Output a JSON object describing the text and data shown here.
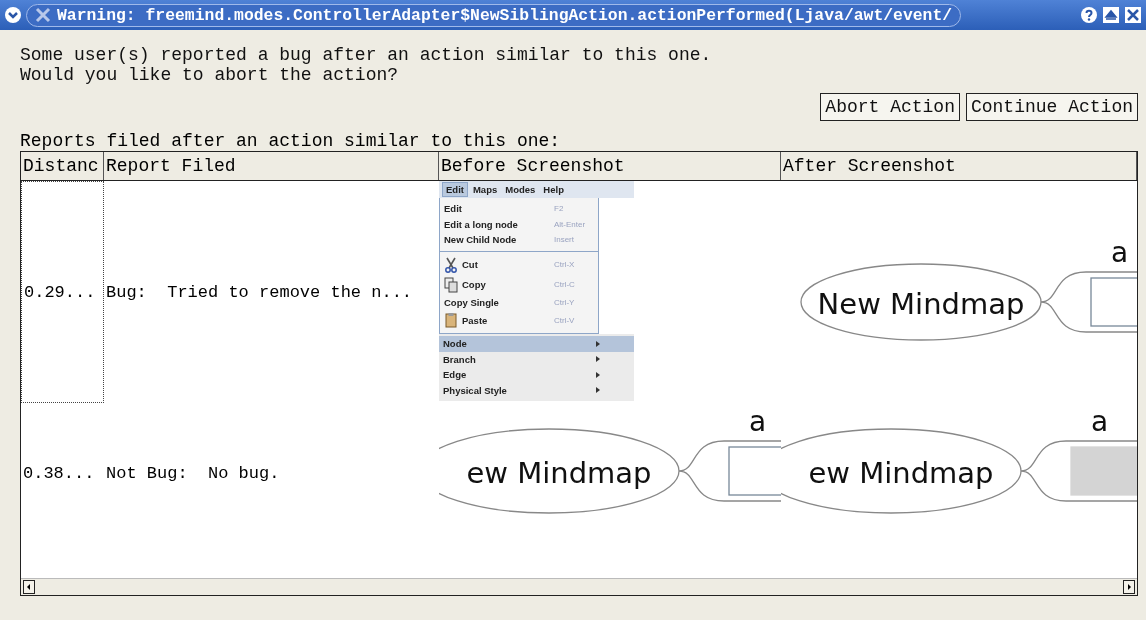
{
  "window": {
    "title": "Warning: freemind.modes.ControllerAdapter$NewSiblingAction.actionPerformed(Ljava/awt/event/"
  },
  "message": [
    "Some user(s) reported a bug after an action similar to this one.",
    "Would you like to abort the action?"
  ],
  "buttons": [
    "Abort Action",
    "Continue Action"
  ],
  "reports_label": "Reports filed after an action similar to this one:",
  "table": {
    "columns": [
      "Distanc",
      "Report Filed",
      "Before Screenshot",
      "After Screenshot"
    ],
    "rows": [
      {
        "distance": "0.29...",
        "report": "Bug:  Tried to remove the n...",
        "focused": true,
        "before": {
          "kind": "menu",
          "menubar": [
            {
              "label": "Edit",
              "selected": true
            },
            {
              "label": "Maps",
              "selected": false
            },
            {
              "label": "Modes",
              "selected": false
            },
            {
              "label": "Help",
              "selected": false
            }
          ],
          "sections": [
            {
              "items": [
                {
                  "kind": "plain",
                  "label": "Edit",
                  "shortcut": "F2"
                },
                {
                  "kind": "plain",
                  "label": "Edit a long node",
                  "shortcut": "Alt-Enter"
                },
                {
                  "kind": "plain",
                  "label": "New Child Node",
                  "shortcut": "Insert"
                }
              ]
            },
            {
              "items": [
                {
                  "kind": "cut",
                  "label": "Cut",
                  "shortcut": "Ctrl-X"
                },
                {
                  "kind": "copy",
                  "label": "Copy",
                  "shortcut": "Ctrl-C"
                },
                {
                  "kind": "plain",
                  "label": "Copy Single",
                  "shortcut": "Ctrl-Y"
                },
                {
                  "kind": "paste",
                  "label": "Paste",
                  "shortcut": "Ctrl-V"
                }
              ]
            },
            {
              "items": [
                {
                  "kind": "submenu",
                  "label": "Node",
                  "selected": true
                },
                {
                  "kind": "submenu",
                  "label": "Branch",
                  "selected": false
                },
                {
                  "kind": "submenu",
                  "label": "Edge",
                  "selected": false
                },
                {
                  "kind": "submenu",
                  "label": "Physical Style",
                  "selected": false
                }
              ]
            }
          ]
        },
        "after": {
          "kind": "mindmap",
          "root": "New Mindmap",
          "child": "a",
          "child_shaded": false
        }
      },
      {
        "distance": "0.38...",
        "report": "Not Bug:  No bug.",
        "focused": false,
        "before": {
          "kind": "mindmap",
          "root": "ew Mindmap",
          "child": "a",
          "child_shaded": false
        },
        "after": {
          "kind": "mindmap",
          "root": "ew Mindmap",
          "child": "a",
          "child_shaded": true
        }
      }
    ]
  }
}
